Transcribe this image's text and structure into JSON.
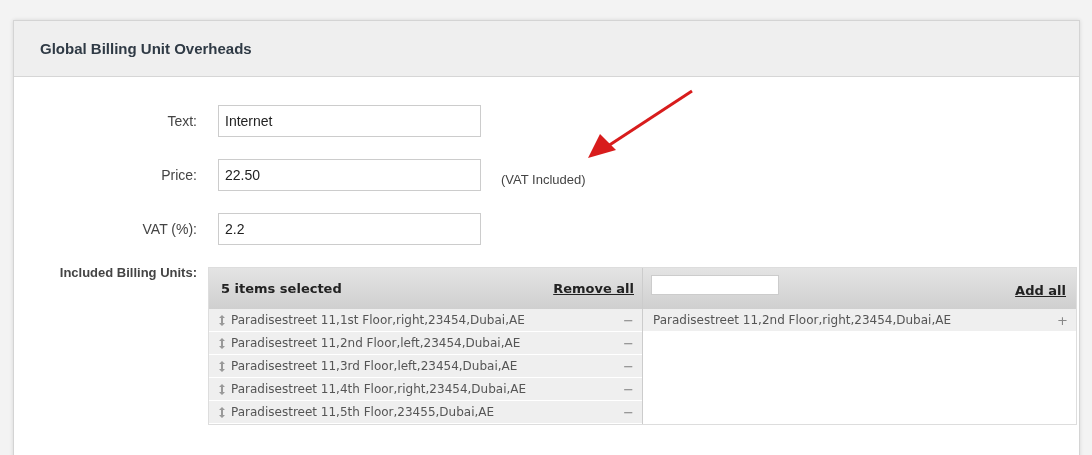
{
  "panel": {
    "title": "Global Billing Unit Overheads"
  },
  "fields": [
    {
      "label": "Text:",
      "value": "Internet"
    },
    {
      "label": "Price:",
      "value": "22.50",
      "note": "(VAT Included)"
    },
    {
      "label": "VAT (%):",
      "value": "2.2"
    }
  ],
  "billing_units": {
    "label": "Included Billing Units:",
    "selected": {
      "count_text": "5 items selected",
      "action": "Remove all",
      "items": [
        {
          "text": "Paradisestreet 11,1st Floor,right,23454,Dubai,AE",
          "button": "−"
        },
        {
          "text": "Paradisestreet 11,2nd Floor,left,23454,Dubai,AE",
          "button": "−"
        },
        {
          "text": "Paradisestreet 11,3rd Floor,left,23454,Dubai,AE",
          "button": "−"
        },
        {
          "text": "Paradisestreet 11,4th Floor,right,23454,Dubai,AE",
          "button": "−"
        },
        {
          "text": "Paradisestreet 11,5th Floor,23455,Dubai,AE",
          "button": "−"
        }
      ]
    },
    "available": {
      "action": "Add all",
      "items": [
        {
          "text": "Paradisestreet 11,2nd Floor,right,23454,Dubai,AE",
          "button": "+"
        }
      ]
    }
  }
}
